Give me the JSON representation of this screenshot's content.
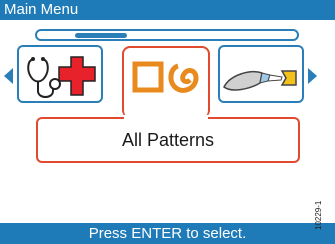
{
  "title_bar": {
    "title": "Main Menu"
  },
  "carousel": {
    "items": [
      {
        "icon": "stethoscope-medical-cross-icon"
      },
      {
        "icon": "patterns-icon"
      },
      {
        "icon": "syringe-icon"
      }
    ],
    "selected_index": 1,
    "scroll_position": 0.2
  },
  "selected_item": {
    "label": "All Patterns"
  },
  "footer": {
    "hint": "Press ENTER to select."
  },
  "figure_id": "10229-1",
  "colors": {
    "title_bar": "#1f7ab8",
    "accent": "#2a7fb8",
    "selection": "#e04a2f",
    "medical_cross": "#e8222b",
    "pattern_orange": "#e88a1e",
    "syringe_yellow": "#f2c21b"
  }
}
